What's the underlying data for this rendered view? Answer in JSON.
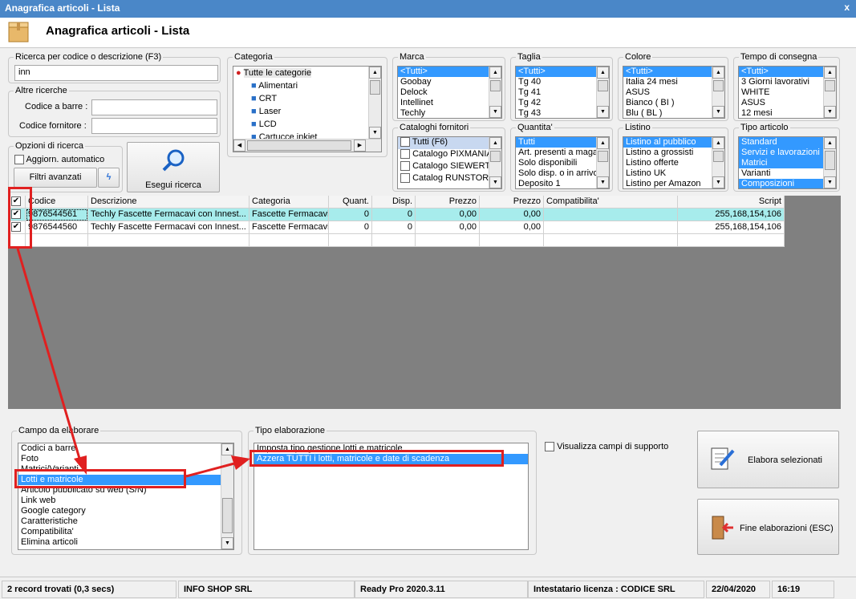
{
  "window": {
    "title": "Anagrafica articoli  - Lista",
    "close": "x"
  },
  "header": {
    "title": "Anagrafica articoli  - Lista"
  },
  "search": {
    "group_label": "Ricerca per codice o descrizione (F3)",
    "value": "inn"
  },
  "altre": {
    "group_label": "Altre ricerche",
    "barcode_label": "Codice a barre :",
    "barcode_value": "",
    "supplier_label": "Codice fornitore :",
    "supplier_value": ""
  },
  "options": {
    "group_label": "Opzioni di ricerca",
    "auto_label": "Aggiorn. automatico",
    "advanced_label": "Filtri avanzati",
    "run_label": "Esegui ricerca"
  },
  "categoria": {
    "label": "Categoria",
    "items": [
      "Tutte le categorie",
      "Alimentari",
      "CRT",
      "Laser",
      "LCD",
      "Cartucce inkjet"
    ]
  },
  "marca": {
    "label": "Marca",
    "items": [
      "<Tutti>",
      "Goobay",
      "Delock",
      "Intellinet",
      "Techly"
    ]
  },
  "taglia": {
    "label": "Taglia",
    "items": [
      "<Tutti>",
      "Tg 40",
      "Tg 41",
      "Tg 42",
      "Tg 43"
    ]
  },
  "colore": {
    "label": "Colore",
    "items": [
      "<Tutti>",
      "Italia 24 mesi",
      "ASUS",
      "Bianco ( BI )",
      "Blu ( BL )"
    ]
  },
  "tempo": {
    "label": "Tempo di consegna",
    "items": [
      "<Tutti>",
      "3 Giorni lavorativi",
      "WHITE",
      "ASUS",
      "12 mesi"
    ]
  },
  "cataloghi": {
    "label": "Cataloghi fornitori",
    "items": [
      "Tutti (F6)",
      "Catalogo PIXMANIA",
      "Catalogo SIEWERT",
      "Catalog RUNSTORE"
    ]
  },
  "quantita": {
    "label": "Quantita'",
    "items": [
      "Tutti",
      "Art. presenti a magazzino",
      "Solo disponibili",
      "Solo disp. o in arrivo",
      "Deposito 1"
    ]
  },
  "listino": {
    "label": "Listino",
    "items": [
      "Listino al pubblico",
      "Listino a grossisti",
      "Listino offerte",
      "Listino UK",
      "Listino per Amazon"
    ]
  },
  "tipo_articolo": {
    "label": "Tipo articolo",
    "items": [
      "Standard",
      "Servizi e lavorazioni",
      "Matrici",
      "Varianti",
      "Composizioni"
    ]
  },
  "grid": {
    "headers": [
      "Codice",
      "Descrizione",
      "Categoria",
      "Quant.",
      "Disp.",
      "Prezzo",
      "Prezzo",
      "Compatibilita'",
      "Script"
    ],
    "rows": [
      [
        "9876544561",
        "Techly Fascette Fermacavi con Innest...",
        "Fascette Fermacavi",
        "0",
        "0",
        "0,00",
        "0,00",
        "",
        "255,168,154,106"
      ],
      [
        "9876544560",
        "Techly Fascette Fermacavi con Innest...",
        "Fascette Fermacavi",
        "0",
        "0",
        "0,00",
        "0,00",
        "",
        "255,168,154,106"
      ]
    ]
  },
  "campo": {
    "label": "Campo da elaborare",
    "items": [
      "Codici a barre",
      "Foto",
      "Matrici/Varianti",
      "Lotti e matricole",
      "Articolo pubblicato su web (S/N)",
      "Link web",
      "Google category",
      "Caratteristiche",
      "Compatibilita'",
      "Elimina articoli"
    ]
  },
  "tipo_elab": {
    "label": "Tipo elaborazione",
    "items": [
      "Imposta tipo gestione lotti e matricole",
      "Azzera TUTTI i lotti, matricole e date di scadenza"
    ]
  },
  "support": {
    "label": "Visualizza campi di supporto"
  },
  "actions": {
    "process": "Elabora selezionati",
    "finish": "Fine elaborazioni (ESC)"
  },
  "status": {
    "records": "2 record trovati (0,3 secs)",
    "company": "INFO SHOP SRL",
    "version": "Ready Pro 2020.3.11",
    "license": "Intestatario licenza : CODICE SRL",
    "date": "22/04/2020",
    "time": "16:19"
  },
  "colors": {
    "selection": "#3399ff",
    "highlight_row": "#a7ecec",
    "annotation": "#e02020",
    "titlebar": "#4a87c8"
  }
}
